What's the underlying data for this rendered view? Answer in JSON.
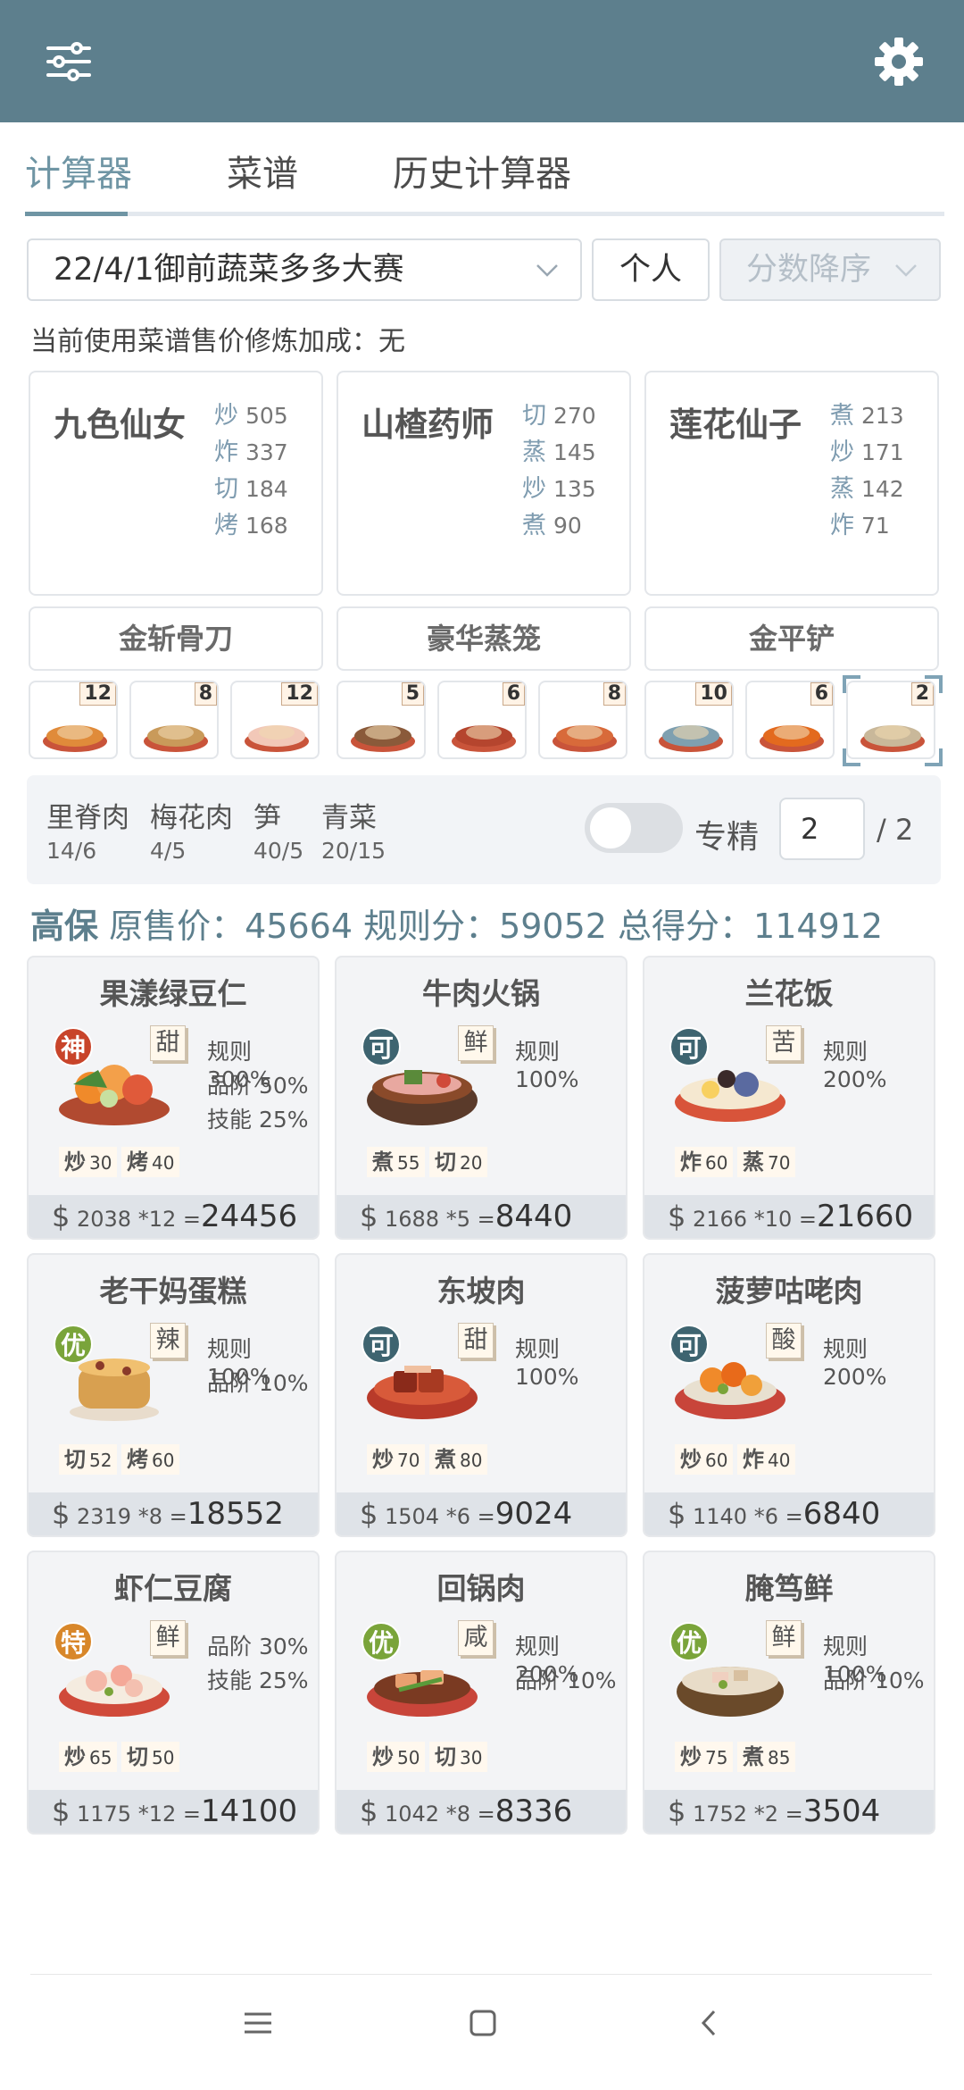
{
  "header": {
    "menu_icon": "sliders-icon",
    "settings_icon": "gear-icon"
  },
  "tabs": [
    {
      "label": "计算器"
    },
    {
      "label": "菜谱"
    },
    {
      "label": "历史计算器"
    }
  ],
  "selectors": {
    "contest": "22/4/1御前蔬菜多多大赛",
    "mode": "个人",
    "sort": "分数降序"
  },
  "note": "当前使用菜谱售价修炼加成：无",
  "chefs": [
    {
      "name": "九色仙女",
      "skills": [
        {
          "l": "炒",
          "v": "505"
        },
        {
          "l": "炸",
          "v": "337"
        },
        {
          "l": "切",
          "v": "184"
        },
        {
          "l": "烤",
          "v": "168"
        }
      ]
    },
    {
      "name": "山楂药师",
      "skills": [
        {
          "l": "切",
          "v": "270"
        },
        {
          "l": "蒸",
          "v": "145"
        },
        {
          "l": "炒",
          "v": "135"
        },
        {
          "l": "煮",
          "v": "90"
        }
      ]
    },
    {
      "name": "莲花仙子",
      "skills": [
        {
          "l": "煮",
          "v": "213"
        },
        {
          "l": "炒",
          "v": "171"
        },
        {
          "l": "蒸",
          "v": "142"
        },
        {
          "l": "炸",
          "v": "71"
        }
      ]
    }
  ],
  "tools": [
    "金斩骨刀",
    "豪华蒸笼",
    "金平铲"
  ],
  "thumbs": [
    "12",
    "8",
    "12",
    "5",
    "6",
    "8",
    "10",
    "6",
    "2"
  ],
  "ingredients": [
    {
      "n": "里脊肉",
      "v": "14/6"
    },
    {
      "n": "梅花肉",
      "v": "4/5"
    },
    {
      "n": "笋",
      "v": "40/5"
    },
    {
      "n": "青菜",
      "v": "20/15"
    }
  ],
  "special": {
    "label": "专精",
    "value": "2",
    "total": "/ 2"
  },
  "summary": {
    "grade": "高保",
    "text": "原售价：45664 规则分：59052 总得分：114912"
  },
  "colors": {
    "header": "#5d7f8d",
    "accent": "#6f95a4"
  },
  "recipes": [
    {
      "name": "果漾绿豆仁",
      "rank": "神",
      "rank_color": "#c8442a",
      "taste": "甜",
      "bonus": [
        "规则 300%",
        "品阶 50%",
        "技能 25%"
      ],
      "m1l": "炒",
      "m1v": "30",
      "m2l": "烤",
      "m2v": "40",
      "price": "$",
      "unit": "2038",
      "mult": "*12",
      "eq": "=",
      "total": "24456",
      "dish": "fruit"
    },
    {
      "name": "牛肉火锅",
      "rank": "可",
      "rank_color": "#3e6470",
      "taste": "鲜",
      "bonus": [
        "规则 100%"
      ],
      "m1l": "煮",
      "m1v": "55",
      "m2l": "切",
      "m2v": "20",
      "price": "$",
      "unit": "1688",
      "mult": "*5",
      "eq": "=",
      "total": "8440",
      "dish": "pot"
    },
    {
      "name": "兰花饭",
      "rank": "可",
      "rank_color": "#3e6470",
      "taste": "苦",
      "bonus": [
        "规则 200%"
      ],
      "m1l": "炸",
      "m1v": "60",
      "m2l": "蒸",
      "m2v": "70",
      "price": "$",
      "unit": "2166",
      "mult": "*10",
      "eq": "=",
      "total": "21660",
      "dish": "rice"
    },
    {
      "name": "老干妈蛋糕",
      "rank": "优",
      "rank_color": "#7aa43a",
      "taste": "辣",
      "bonus": [
        "规则 100%",
        "品阶 10%"
      ],
      "m1l": "切",
      "m1v": "52",
      "m2l": "烤",
      "m2v": "60",
      "price": "$",
      "unit": "2319",
      "mult": "*8",
      "eq": "=",
      "total": "18552",
      "dish": "cake"
    },
    {
      "name": "东坡肉",
      "rank": "可",
      "rank_color": "#3e6470",
      "taste": "甜",
      "bonus": [
        "规则 100%"
      ],
      "m1l": "炒",
      "m1v": "70",
      "m2l": "煮",
      "m2v": "80",
      "price": "$",
      "unit": "1504",
      "mult": "*6",
      "eq": "=",
      "total": "9024",
      "dish": "pork"
    },
    {
      "name": "菠萝咕咾肉",
      "rank": "可",
      "rank_color": "#3e6470",
      "taste": "酸",
      "bonus": [
        "规则 200%"
      ],
      "m1l": "炒",
      "m1v": "60",
      "m2l": "炸",
      "m2v": "40",
      "price": "$",
      "unit": "1140",
      "mult": "*6",
      "eq": "=",
      "total": "6840",
      "dish": "sweet"
    },
    {
      "name": "虾仁豆腐",
      "rank": "特",
      "rank_color": "#d8872a",
      "taste": "鲜",
      "bonus": [
        "品阶 30%",
        "技能 25%"
      ],
      "m1l": "炒",
      "m1v": "65",
      "m2l": "切",
      "m2v": "50",
      "price": "$",
      "unit": "1175",
      "mult": "*12",
      "eq": "=",
      "total": "14100",
      "dish": "shrimp"
    },
    {
      "name": "回锅肉",
      "rank": "优",
      "rank_color": "#7aa43a",
      "taste": "咸",
      "bonus": [
        "规则 200%",
        "品阶 10%"
      ],
      "m1l": "炒",
      "m1v": "50",
      "m2l": "切",
      "m2v": "30",
      "price": "$",
      "unit": "1042",
      "mult": "*8",
      "eq": "=",
      "total": "8336",
      "dish": "twice"
    },
    {
      "name": "腌笃鲜",
      "rank": "优",
      "rank_color": "#7aa43a",
      "taste": "鲜",
      "bonus": [
        "规则 100%",
        "品阶 10%"
      ],
      "m1l": "炒",
      "m1v": "75",
      "m2l": "煮",
      "m2v": "85",
      "price": "$",
      "unit": "1752",
      "mult": "*2",
      "eq": "=",
      "total": "3504",
      "dish": "soup"
    }
  ],
  "nav": {
    "menu": "menu-icon",
    "home": "home-icon",
    "back": "back-icon"
  }
}
